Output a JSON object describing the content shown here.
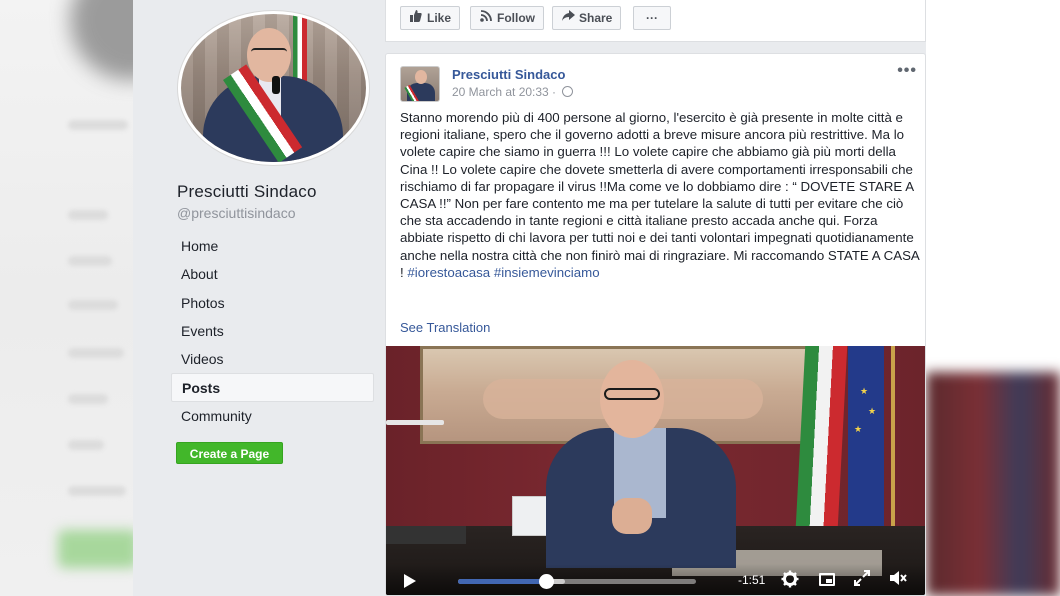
{
  "page": {
    "name": "Presciutti Sindaco",
    "handle": "@presciuttisindaco"
  },
  "nav": {
    "items": [
      {
        "label": "Home",
        "active": false
      },
      {
        "label": "About",
        "active": false
      },
      {
        "label": "Photos",
        "active": false
      },
      {
        "label": "Events",
        "active": false
      },
      {
        "label": "Videos",
        "active": false
      },
      {
        "label": "Posts",
        "active": true
      },
      {
        "label": "Community",
        "active": false
      }
    ],
    "create_page_label": "Create a Page"
  },
  "actions": {
    "like_label": "Like",
    "follow_label": "Follow",
    "share_label": "Share",
    "more_label": "···"
  },
  "post": {
    "author": "Presciutti Sindaco",
    "timestamp": "20 March at 20:33 ·",
    "more_label": "•••",
    "body": "Stanno morendo più di 400 persone al giorno, l'esercito è già presente in molte città e regioni italiane, spero che il governo adotti a breve misure ancora più restrittive. Ma lo volete capire che siamo in guerra !!! Lo volete capire che abbiamo già più morti della Cina !! Lo volete capire che dovete smetterla di avere comportamenti irresponsabili che rischiamo di far propagare il virus !!Ma come ve lo dobbiamo dire : “ DOVETE STARE A CASA !!” Non per fare contento me ma per tutelare la salute di tutti per evitare che ciò che sta accadendo in tante regioni e città italiane presto accada anche qui. Forza abbiate rispetto di chi lavora per tutti noi e dei tanti volontari impegnati quotidianamente anche nella nostra città che non finirò mai di ringraziare. Mi raccomando STATE A CASA !",
    "hashtag1": "#iorestoacasa",
    "hashtag2": "#insiemevinciamo",
    "see_translation": "See Translation"
  },
  "video": {
    "time_remaining": "-1:51",
    "progress": 0.37,
    "buffered": 0.45,
    "icons": [
      "play-icon",
      "settings-icon",
      "fullscreen-icon",
      "expand-icon",
      "volume-icon"
    ]
  },
  "colors": {
    "link": "#365899",
    "create_button": "#42b72a",
    "page_bg": "#e9ebee",
    "progress": "#4267b2"
  }
}
